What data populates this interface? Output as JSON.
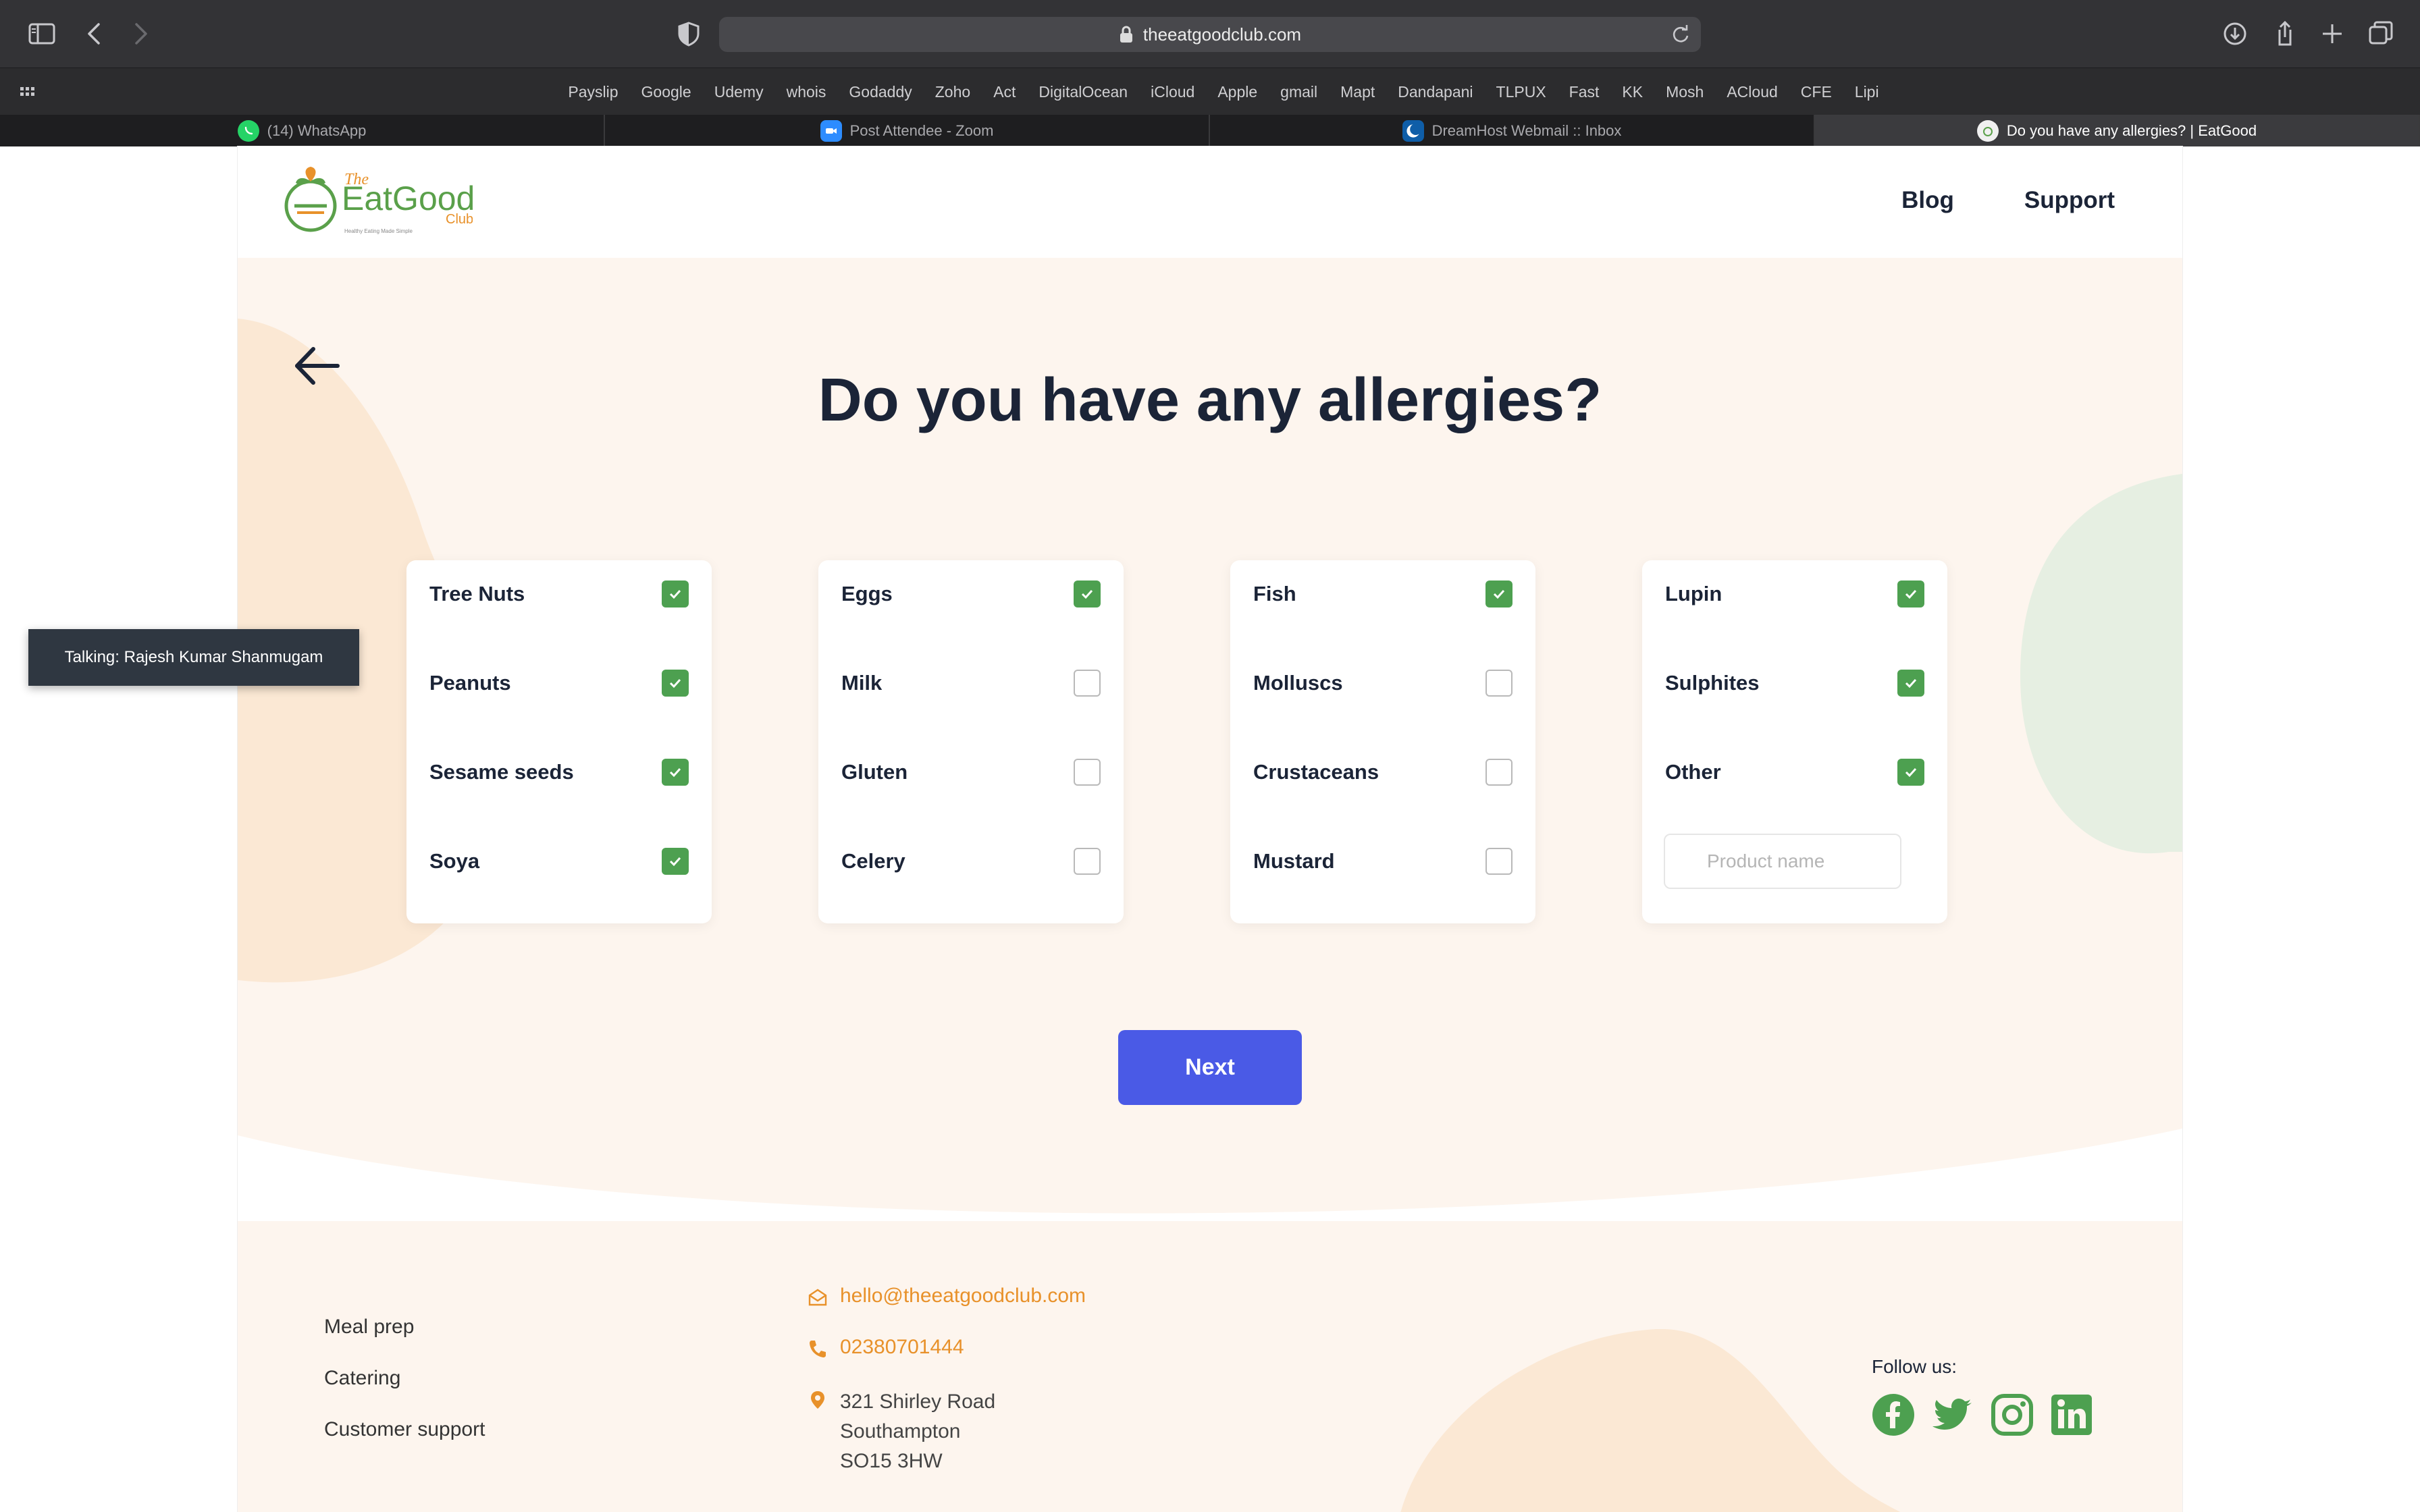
{
  "browser": {
    "url": "theeatgoodclub.com",
    "bookmarks": [
      "Payslip",
      "Google",
      "Udemy",
      "whois",
      "Godaddy",
      "Zoho",
      "Act",
      "DigitalOcean",
      "iCloud",
      "Apple",
      "gmail",
      "Mapt",
      "Dandapani",
      "TLPUX",
      "Fast",
      "KK",
      "Mosh",
      "ACloud",
      "CFE",
      "Lipi"
    ],
    "tabs": [
      {
        "label": "(14) WhatsApp",
        "icon": "whatsapp-icon"
      },
      {
        "label": "Post Attendee - Zoom",
        "icon": "zoom-icon"
      },
      {
        "label": "DreamHost Webmail :: Inbox",
        "icon": "dreamhost-icon"
      },
      {
        "label": "Do you have any allergies? | EatGood",
        "icon": "eatgood-icon",
        "active": true
      }
    ]
  },
  "header": {
    "logo_text": {
      "the": "The",
      "main": "EatGood",
      "club": "Club",
      "tagline": "Healthy Eating Made Simple"
    },
    "nav": [
      "Blog",
      "Support"
    ]
  },
  "question": {
    "title": "Do you have any allergies?",
    "columns": [
      [
        {
          "label": "Tree Nuts",
          "checked": true
        },
        {
          "label": "Peanuts",
          "checked": true
        },
        {
          "label": "Sesame seeds",
          "checked": true
        },
        {
          "label": "Soya",
          "checked": true
        }
      ],
      [
        {
          "label": "Eggs",
          "checked": true
        },
        {
          "label": "Milk",
          "checked": false
        },
        {
          "label": "Gluten",
          "checked": false
        },
        {
          "label": "Celery",
          "checked": false
        }
      ],
      [
        {
          "label": "Fish",
          "checked": true
        },
        {
          "label": "Molluscs",
          "checked": false
        },
        {
          "label": "Crustaceans",
          "checked": false
        },
        {
          "label": "Mustard",
          "checked": false
        }
      ],
      [
        {
          "label": "Lupin",
          "checked": true
        },
        {
          "label": "Sulphites",
          "checked": true
        },
        {
          "label": "Other",
          "checked": true
        }
      ]
    ],
    "other_placeholder": "Product name",
    "next_label": "Next"
  },
  "footer": {
    "links": [
      "Meal prep",
      "Catering",
      "Customer support"
    ],
    "email": "hello@theeatgoodclub.com",
    "phone": "02380701444",
    "address": [
      "321 Shirley Road",
      "Southampton",
      "SO15 3HW"
    ],
    "follow_label": "Follow us:",
    "social": [
      "facebook-icon",
      "twitter-icon",
      "instagram-icon",
      "linkedin-icon"
    ]
  },
  "overlay": {
    "zoom_talking": "Talking: Rajesh Kumar Shanmugam"
  },
  "colors": {
    "accent_green": "#4da050",
    "brand_orange": "#e8912a",
    "primary_button": "#4a5ae6",
    "heading": "#1b2437",
    "hero_bg": "#fdf5ee"
  }
}
